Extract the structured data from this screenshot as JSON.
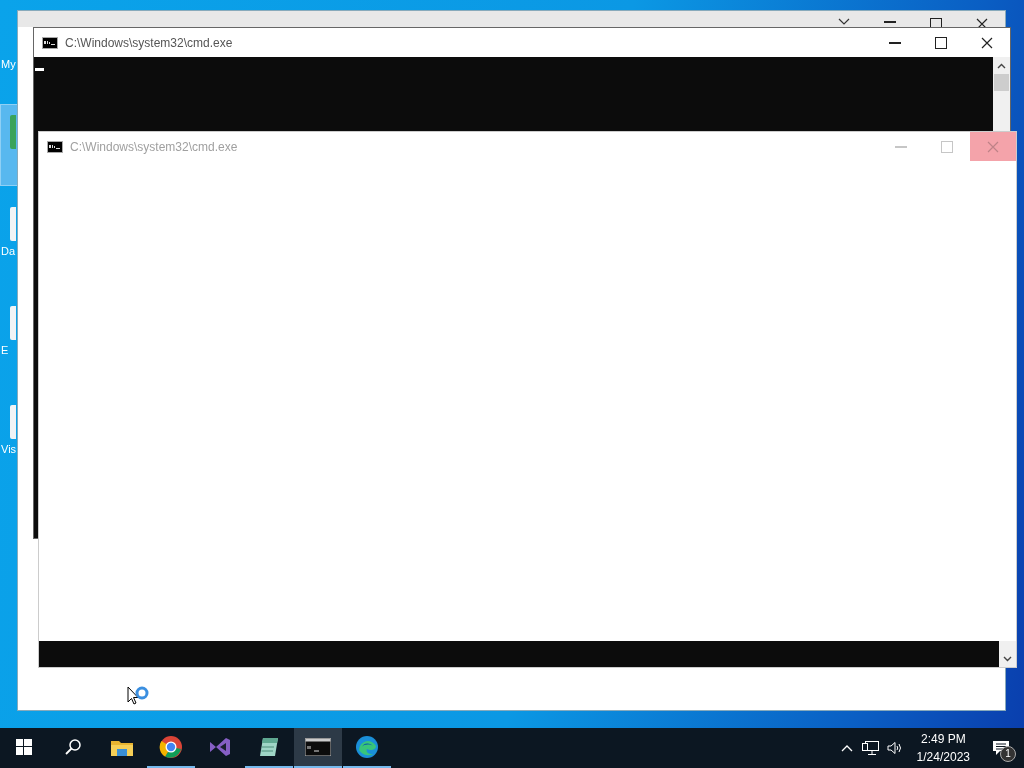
{
  "desktop": {
    "icons": [
      {
        "label": "My",
        "selected": false
      },
      {
        "selected": true
      },
      {
        "label": "Da",
        "selected": false
      },
      {
        "label": "E",
        "selected": false
      },
      {
        "label": "Vis",
        "selected": false
      }
    ]
  },
  "windows": [
    {
      "kind": "explorer"
    },
    {
      "kind": "console",
      "title": "C:\\Windows\\system32\\cmd.exe",
      "cursor_visible": true,
      "close_hover": false,
      "faded": false,
      "scrolled_to_end": false
    },
    {
      "kind": "console",
      "title": "C:\\Windows\\system32\\cmd.exe",
      "cursor_visible": false,
      "close_hover": true,
      "faded": true,
      "scrolled_to_end": true
    }
  ],
  "pointer": {
    "busy": true
  },
  "taskbar": {
    "apps": [
      {
        "kind": "start",
        "running": false,
        "selected": false
      },
      {
        "kind": "search",
        "running": false,
        "selected": false
      },
      {
        "kind": "folder",
        "running": false,
        "selected": false
      },
      {
        "kind": "chrome",
        "running": true,
        "selected": false
      },
      {
        "kind": "studio",
        "running": false,
        "selected": false
      },
      {
        "kind": "notes",
        "running": true,
        "selected": false
      },
      {
        "kind": "terminal",
        "running": true,
        "selected": true
      },
      {
        "kind": "edge",
        "running": true,
        "selected": false
      }
    ],
    "tray": {
      "time": "2:49 PM",
      "date": "1/24/2023",
      "notifications": "1"
    }
  }
}
